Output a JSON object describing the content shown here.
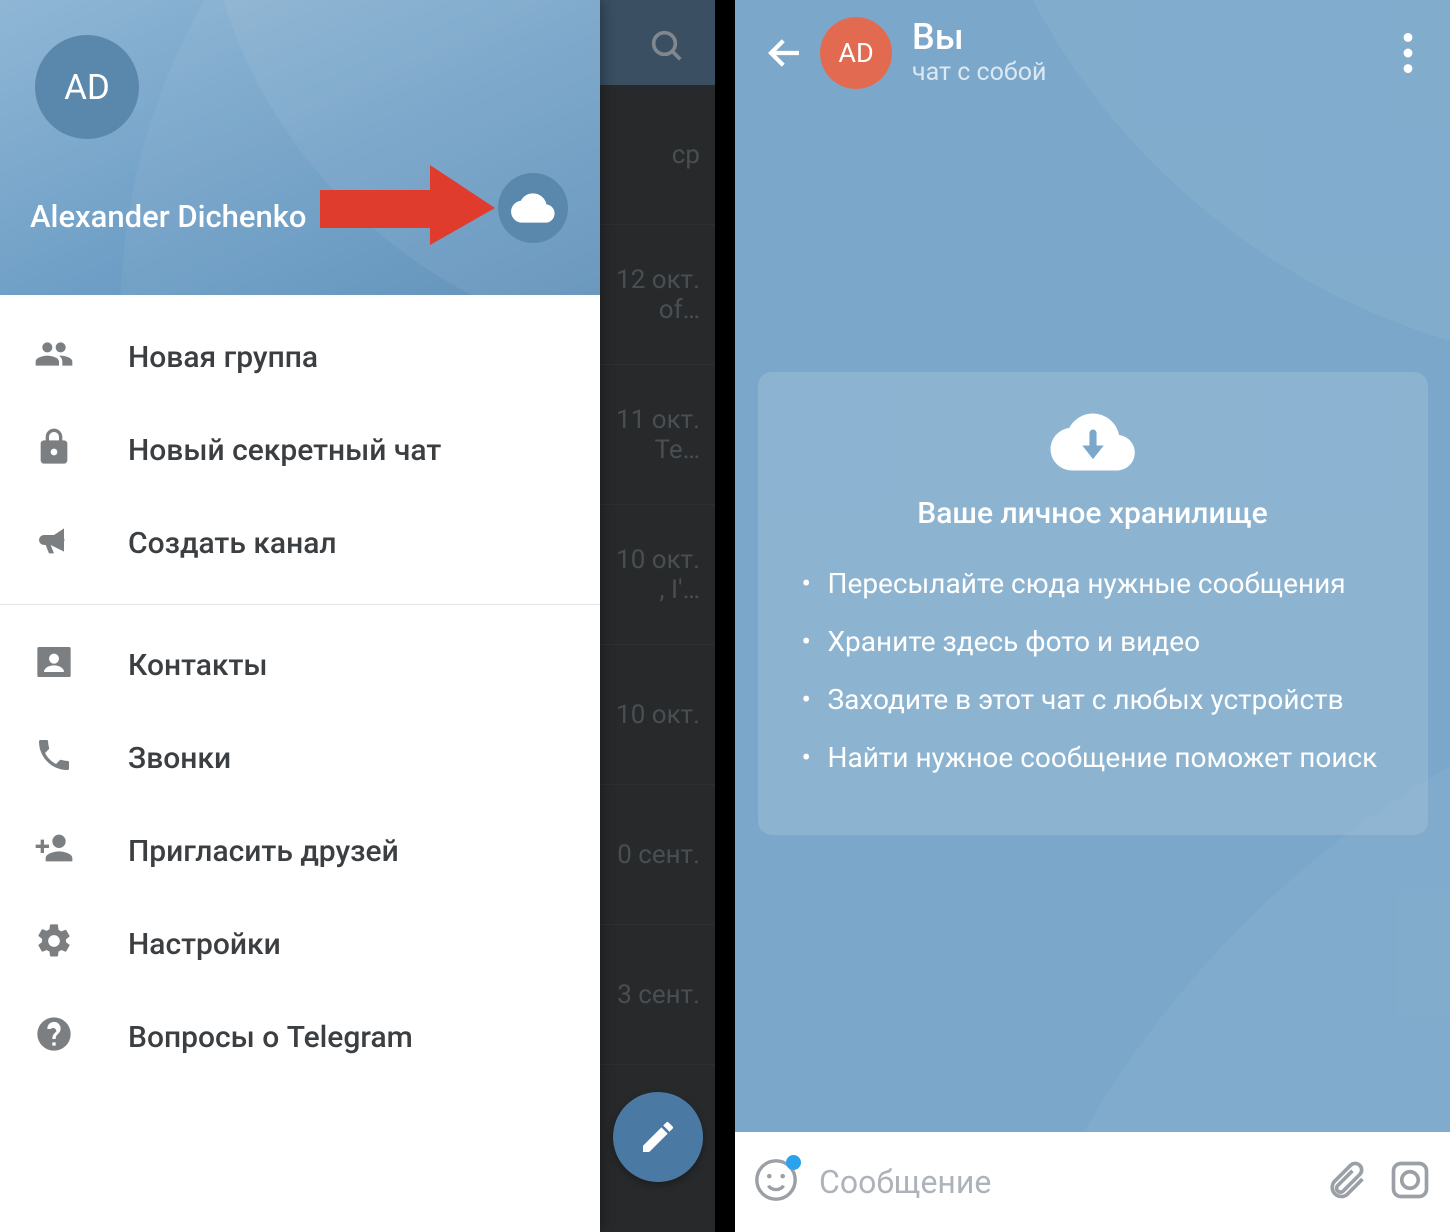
{
  "left": {
    "avatar_initials": "AD",
    "user_name": "Alexander Dichenko",
    "menu": {
      "new_group": "Новая группа",
      "secret_chat": "Новый секретный чат",
      "new_channel": "Создать канал",
      "contacts": "Контакты",
      "calls": "Звонки",
      "invite": "Пригласить друзей",
      "settings": "Настройки",
      "faq": "Вопросы о Telegram"
    },
    "ghost_dates": {
      "d0": "ср",
      "d1": "12 окт.",
      "d1b": "of…",
      "d2": "11 окт.",
      "d2b": "Te…",
      "d3": "10 окт.",
      "d3b": ", I'…",
      "d4": "10 окт.",
      "d5": "0 сент.",
      "d6": "3 сент."
    }
  },
  "right": {
    "avatar_initials": "AD",
    "title": "Вы",
    "subtitle": "чат с собой",
    "card_title": "Ваше личное хранилище",
    "bullets": {
      "b1": "Пересылайте сюда нужные сообщения",
      "b2": "Храните здесь фото и видео",
      "b3": "Заходите в этот чат с любых устройств",
      "b4": "Найти нужное сообщение поможет поиск"
    },
    "input_placeholder": "Сообщение"
  },
  "colors": {
    "accent_red": "#e03c2e",
    "header_blue": "#7ba8ca",
    "orange": "#e26a51"
  }
}
